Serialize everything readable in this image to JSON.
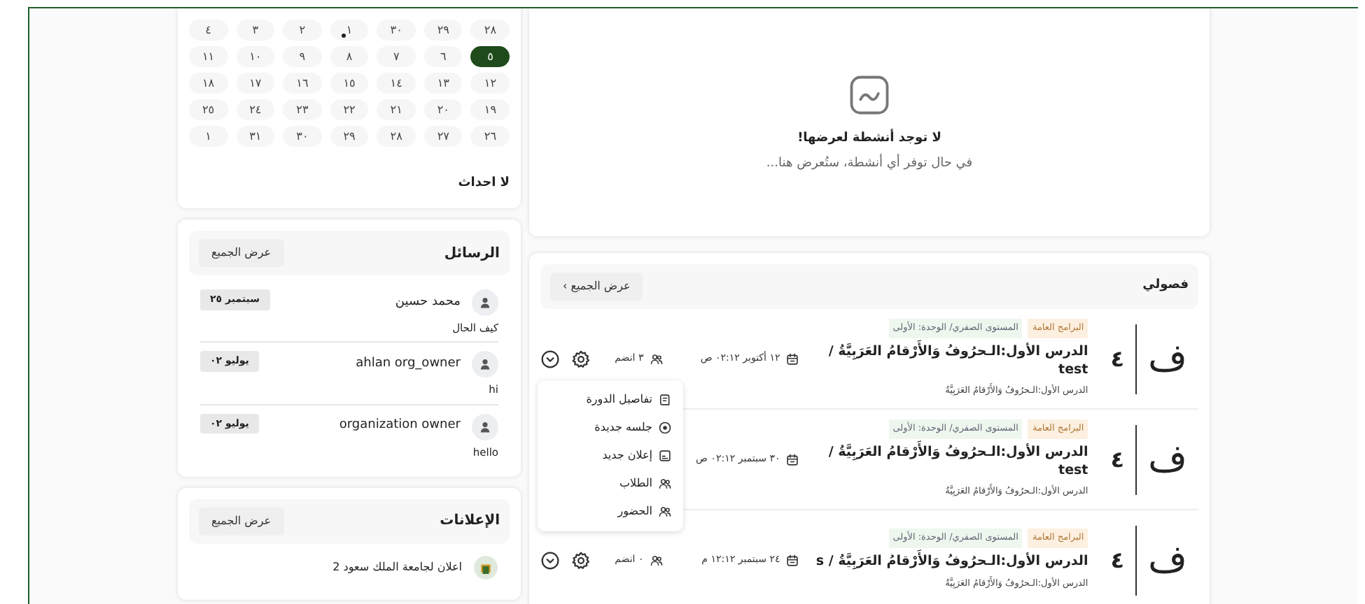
{
  "calendar": {
    "weeks": [
      [
        {
          "day": "٢٨",
          "selected": false,
          "dot": false
        },
        {
          "day": "٢٩",
          "selected": false,
          "dot": false
        },
        {
          "day": "٣٠",
          "selected": false,
          "dot": false
        },
        {
          "day": "١",
          "selected": false,
          "dot": true
        },
        {
          "day": "٢",
          "selected": false,
          "dot": false
        },
        {
          "day": "٣",
          "selected": false,
          "dot": false
        },
        {
          "day": "٤",
          "selected": false,
          "dot": false
        }
      ],
      [
        {
          "day": "٥",
          "selected": true,
          "dot": false
        },
        {
          "day": "٦",
          "selected": false,
          "dot": false
        },
        {
          "day": "٧",
          "selected": false,
          "dot": false
        },
        {
          "day": "٨",
          "selected": false,
          "dot": false
        },
        {
          "day": "٩",
          "selected": false,
          "dot": false
        },
        {
          "day": "١٠",
          "selected": false,
          "dot": false
        },
        {
          "day": "١١",
          "selected": false,
          "dot": false
        }
      ],
      [
        {
          "day": "١٢",
          "selected": false,
          "dot": false
        },
        {
          "day": "١٣",
          "selected": false,
          "dot": false
        },
        {
          "day": "١٤",
          "selected": false,
          "dot": false
        },
        {
          "day": "١٥",
          "selected": false,
          "dot": false
        },
        {
          "day": "١٦",
          "selected": false,
          "dot": false
        },
        {
          "day": "١٧",
          "selected": false,
          "dot": false
        },
        {
          "day": "١٨",
          "selected": false,
          "dot": false
        }
      ],
      [
        {
          "day": "١٩",
          "selected": false,
          "dot": false
        },
        {
          "day": "٢٠",
          "selected": false,
          "dot": false
        },
        {
          "day": "٢١",
          "selected": false,
          "dot": false
        },
        {
          "day": "٢٢",
          "selected": false,
          "dot": false
        },
        {
          "day": "٢٣",
          "selected": false,
          "dot": false
        },
        {
          "day": "٢٤",
          "selected": false,
          "dot": false
        },
        {
          "day": "٢٥",
          "selected": false,
          "dot": false
        }
      ],
      [
        {
          "day": "٢٦",
          "selected": false,
          "dot": false
        },
        {
          "day": "٢٧",
          "selected": false,
          "dot": false
        },
        {
          "day": "٢٨",
          "selected": false,
          "dot": false
        },
        {
          "day": "٢٩",
          "selected": false,
          "dot": false
        },
        {
          "day": "٣٠",
          "selected": false,
          "dot": false
        },
        {
          "day": "٣١",
          "selected": false,
          "dot": false
        },
        {
          "day": "١",
          "selected": false,
          "dot": false
        }
      ]
    ],
    "empty_text": "لا احداث"
  },
  "messages": {
    "title": "الرسائل",
    "view_all": "عرض الجميع",
    "items": [
      {
        "name": "محمد حسين",
        "date": "سبتمبر ٢٥",
        "text": "كيف الحال"
      },
      {
        "name": "ahlan org_owner",
        "date": "يوليو ٠٢",
        "text": "hi"
      },
      {
        "name": "organization owner",
        "date": "يوليو ٠٢",
        "text": "hello"
      }
    ]
  },
  "announcements": {
    "title": "الإعلانات",
    "view_all": "عرض الجميع",
    "items": [
      {
        "text": "اعلان لجامعة الملك سعود 2"
      }
    ]
  },
  "activity": {
    "title": "لا توجد أنشطة لعرضها!",
    "subtitle": "في حال توفر أي أنشطة، ستُعرض هنا..."
  },
  "courses": {
    "title": "فصولي",
    "view_all": "عرض الجميع",
    "view_all_icon": "›",
    "items": [
      {
        "initial": "ف",
        "number": "٤",
        "tags": [
          "البرامج العامة",
          "المستوى الصفري/ الوحدة: الأولى"
        ],
        "title": "الدرس الأول:الـحرُوفُ وَالأَرْقامُ العَرَبِيَّةُ / test",
        "subtitle": "الدرس الأول:الـحرُوفُ وَالأَرْقامُ العَرَبِيَّةُ",
        "date": "١٢ أكتوبر ٠٢:١٢ ص",
        "members": "٣ انضم",
        "menu_open": true
      },
      {
        "initial": "ف",
        "number": "٤",
        "tags": [
          "البرامج العامة",
          "المستوى الصفري/ الوحدة: الأولى"
        ],
        "title": "الدرس الأول:الـحرُوفُ وَالأَرْقامُ العَرَبِيَّةُ / test",
        "subtitle": "الدرس الأول:الـحرُوفُ وَالأَرْقامُ العَرَبِيَّةُ",
        "date": "٣٠ سبتمبر ٠٢:١٢ ص",
        "menu_open": false
      },
      {
        "initial": "ف",
        "number": "٤",
        "tags": [
          "البرامج العامة",
          "المستوى الصفري/ الوحدة: الأولى"
        ],
        "title": "الدرس الأول:الـحرُوفُ وَالأَرْقامُ العَرَبِيَّةُ / s",
        "subtitle": "الدرس الأول:الـحرُوفُ وَالأَرْقامُ العَرَبِيَّةُ",
        "date": "٢٤ سبتمبر ١٢:١٢ م",
        "members": "٠ انضم",
        "menu_open": false
      }
    ]
  },
  "course_menu": {
    "items": [
      {
        "label": "تفاصيل الدورة",
        "kind": "details"
      },
      {
        "label": "جلسه جديدة",
        "kind": "session"
      },
      {
        "label": "إعلان جديد",
        "kind": "announcement"
      },
      {
        "label": "الطلاب",
        "kind": "students"
      },
      {
        "label": "الحضور",
        "kind": "attendance"
      }
    ]
  }
}
